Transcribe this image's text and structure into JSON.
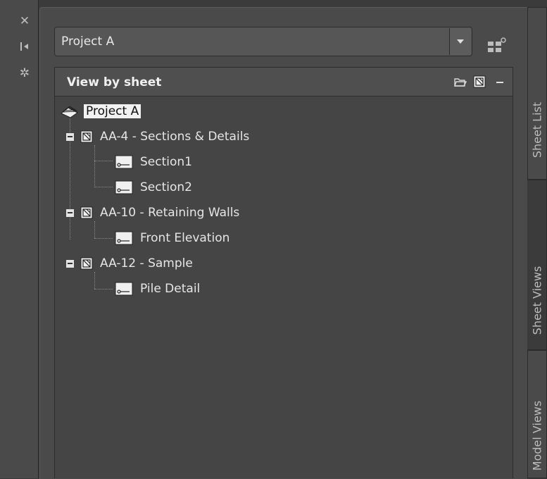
{
  "palette_controls": {
    "close_glyph": "✕",
    "collapse_glyph": "⇤",
    "settings_glyph": "✲"
  },
  "project_selector": {
    "value": "Project A"
  },
  "tree": {
    "header_title": "View by sheet",
    "root_label": "Project A",
    "sheets": [
      {
        "label": "AA-4 - Sections & Details",
        "views": [
          "Section1",
          "Section2"
        ]
      },
      {
        "label": "AA-10 - Retaining Walls",
        "views": [
          "Front Elevation"
        ]
      },
      {
        "label": "AA-12 - Sample",
        "views": [
          "Pile Detail"
        ]
      }
    ]
  },
  "side_tabs": {
    "sheet_list": "Sheet List",
    "sheet_views": "Sheet Views",
    "model_views": "Model Views"
  },
  "colors": {
    "background": "#3b3b3b",
    "panel": "#4a4a4a",
    "selection": "#f2f2f2",
    "text": "#e6e6e6"
  }
}
